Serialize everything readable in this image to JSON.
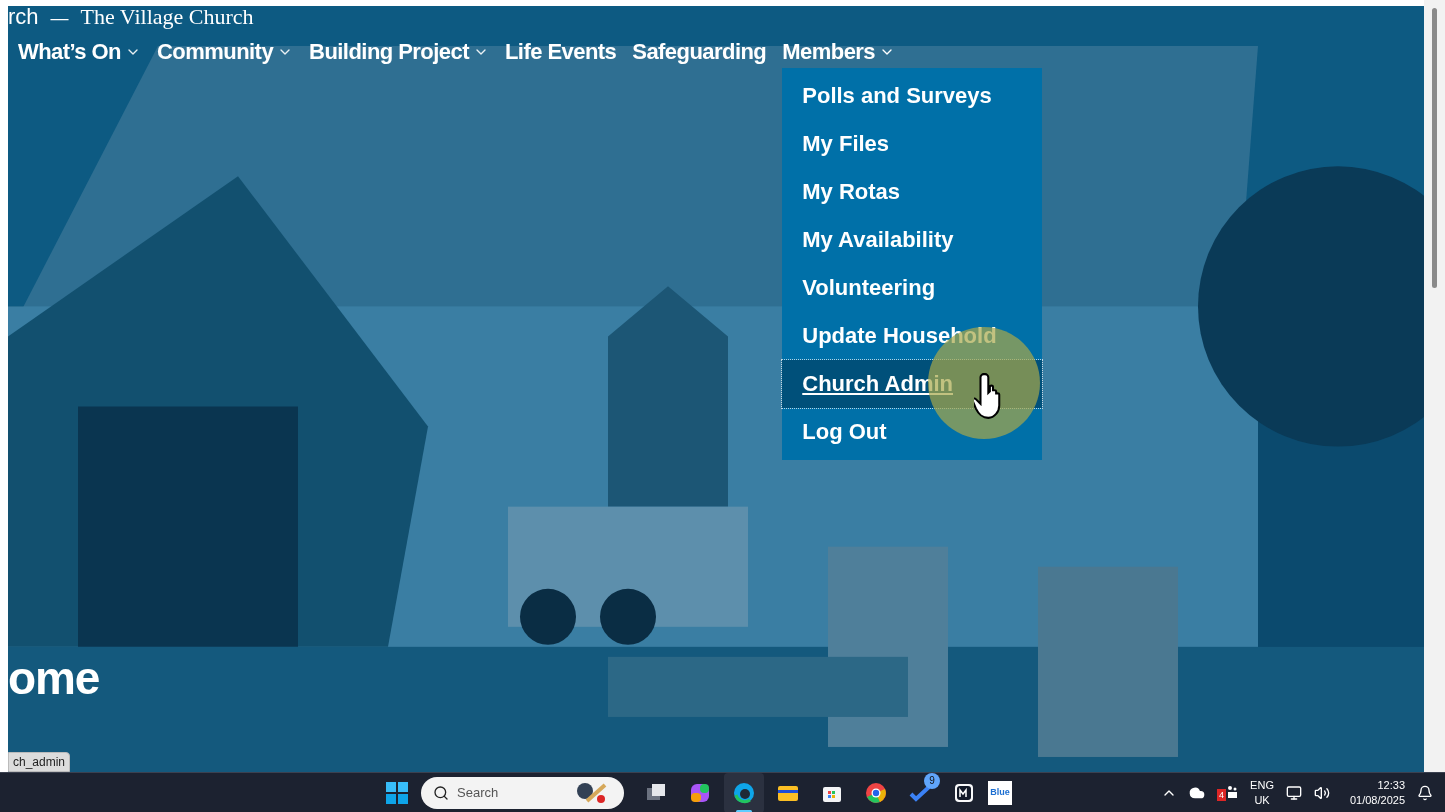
{
  "site": {
    "name": "rch",
    "separator": "—",
    "tagline": "The Village Church"
  },
  "nav": [
    {
      "label": "What’s On",
      "has_dropdown": true,
      "expanded": false
    },
    {
      "label": "Community",
      "has_dropdown": true,
      "expanded": false
    },
    {
      "label": "Building Project",
      "has_dropdown": true,
      "expanded": false
    },
    {
      "label": "Life Events",
      "has_dropdown": false,
      "expanded": false
    },
    {
      "label": "Safeguarding",
      "has_dropdown": false,
      "expanded": false
    },
    {
      "label": "Members",
      "has_dropdown": true,
      "expanded": true
    }
  ],
  "dropdown": [
    {
      "label": "Polls and Surveys",
      "selected": false
    },
    {
      "label": "My Files",
      "selected": false
    },
    {
      "label": "My Rotas",
      "selected": false
    },
    {
      "label": "My Availability",
      "selected": false
    },
    {
      "label": "Volunteering",
      "selected": false
    },
    {
      "label": "Update Household",
      "selected": false
    },
    {
      "label": "Church Admin",
      "selected": true
    },
    {
      "label": "Log Out",
      "selected": false
    }
  ],
  "hero": {
    "kind": "picture",
    "heading": "ome"
  },
  "status_url": "ch_admin",
  "taskbar": {
    "search": {
      "placeholder": "Search"
    },
    "apps": [
      {
        "kind": "taskview",
        "active": false
      },
      {
        "kind": "copilot",
        "active": false
      },
      {
        "kind": "edge",
        "active": true
      },
      {
        "kind": "files",
        "active": false
      },
      {
        "kind": "store",
        "active": false
      },
      {
        "kind": "chrome",
        "active": false
      },
      {
        "kind": "todo",
        "active": false,
        "badge": "9"
      },
      {
        "kind": "app",
        "active": false
      },
      {
        "kind": "blue",
        "active": false,
        "label": "Blue"
      }
    ],
    "tray": {
      "badge": "4",
      "language": "ENG",
      "region": "UK",
      "time": "12:33",
      "date": "01/08/2025"
    }
  }
}
